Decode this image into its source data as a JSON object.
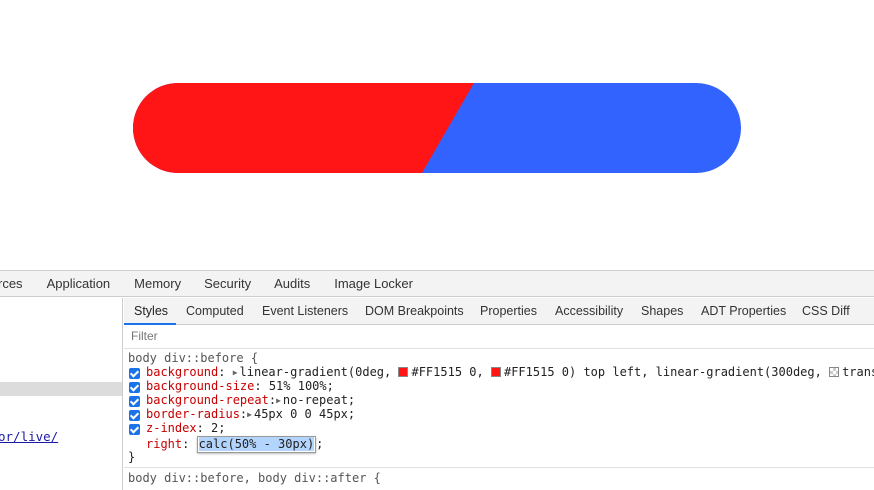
{
  "preview": {
    "gradient_colors": {
      "left": "#FF1515",
      "right": "#3263FF"
    }
  },
  "devtools": {
    "main_tabs": [
      "rces",
      "Application",
      "Memory",
      "Security",
      "Audits",
      "Image Locker"
    ],
    "left_pane": {
      "link_text": "or/live/"
    },
    "sub_tabs": [
      "Styles",
      "Computed",
      "Event Listeners",
      "DOM Breakpoints",
      "Properties",
      "Accessibility",
      "Shapes",
      "ADT Properties",
      "CSS Diff"
    ],
    "active_sub_tab": "Styles",
    "filter_placeholder": "Filter",
    "rule1": {
      "selector": "body div::before {",
      "decls": [
        {
          "prop": "background",
          "value_a": "linear-gradient(0deg, ",
          "color1": "#FF1515 0, ",
          "color2": "#FF1515 0) top left, linear-gradient(300deg, ",
          "tail": "trans"
        },
        {
          "prop": "background-size",
          "value": "51% 100%;"
        },
        {
          "prop": "background-repeat",
          "value": "no-repeat;"
        },
        {
          "prop": "border-radius",
          "value": "45px 0 0 45px;"
        },
        {
          "prop": "z-index",
          "value": "2;"
        },
        {
          "prop": "right",
          "value": "calc(50% - 30px)",
          "end": ";"
        }
      ],
      "close": "}"
    },
    "rule2": {
      "selector": "body div::before, body div::after {"
    }
  }
}
